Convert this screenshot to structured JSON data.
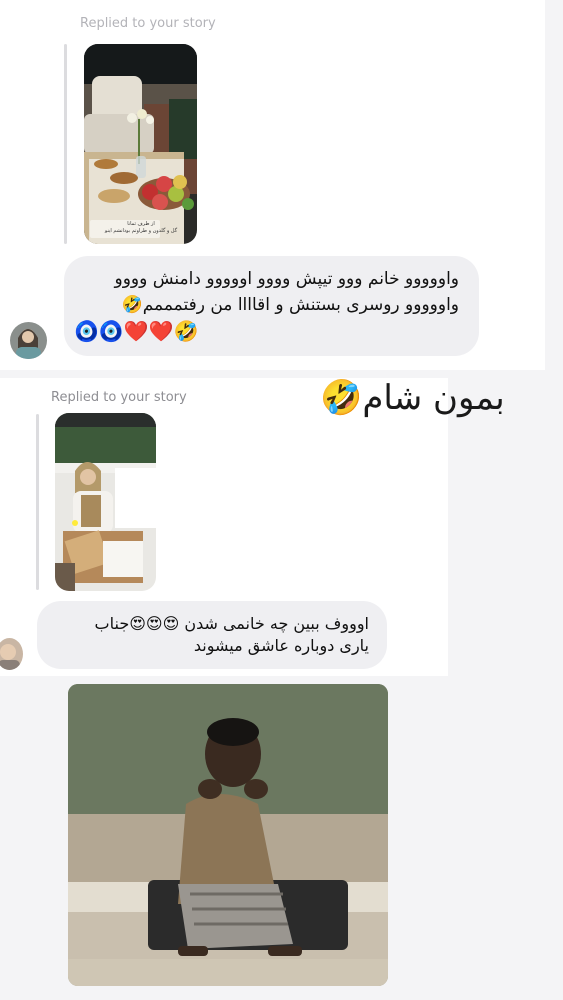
{
  "message1": {
    "replied_label": "Replied to your story",
    "story_caption_line1": "از طرف ثمانا",
    "story_caption_line2": "گل و گلدون و طراوتم بودانشم اینو",
    "text_lines": [
      "واووووو خانم ووو تیپش وووو اووووو دامنش وووو",
      "واووووو روسری بستنش و اقاااا من رفتمممم🤣",
      "🧿🧿❤️❤️🤣"
    ]
  },
  "message2": {
    "replied_label": "Replied to your story",
    "overlay_text": "بمون شام🤣",
    "text_lines": [
      "اوووف ببین چه خانمی شدن 😍😍😍جناب",
      "یاری دوباره عاشق میشوند"
    ]
  },
  "icons": {
    "avatar1": "user-avatar-icon",
    "avatar2": "user-avatar-icon",
    "meme": "sad-boy-meme-image"
  },
  "colors": {
    "background": "#f4f4f6",
    "card": "#ffffff",
    "bubble": "#efeff2",
    "muted_text": "#8e8e93"
  }
}
